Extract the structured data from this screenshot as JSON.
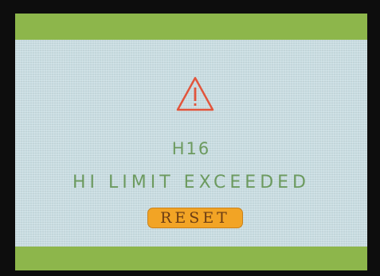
{
  "error": {
    "code": "H16",
    "message": "HI LIMIT EXCEEDED"
  },
  "actions": {
    "reset_label": "RESET"
  },
  "icons": {
    "warning": "warning-triangle-icon"
  },
  "colors": {
    "background": "#c9dde2",
    "bar": "#8db64b",
    "text": "#6c9a5f",
    "warning": "#e2553c",
    "button": "#f2a425",
    "button_text": "#6b3d14"
  }
}
